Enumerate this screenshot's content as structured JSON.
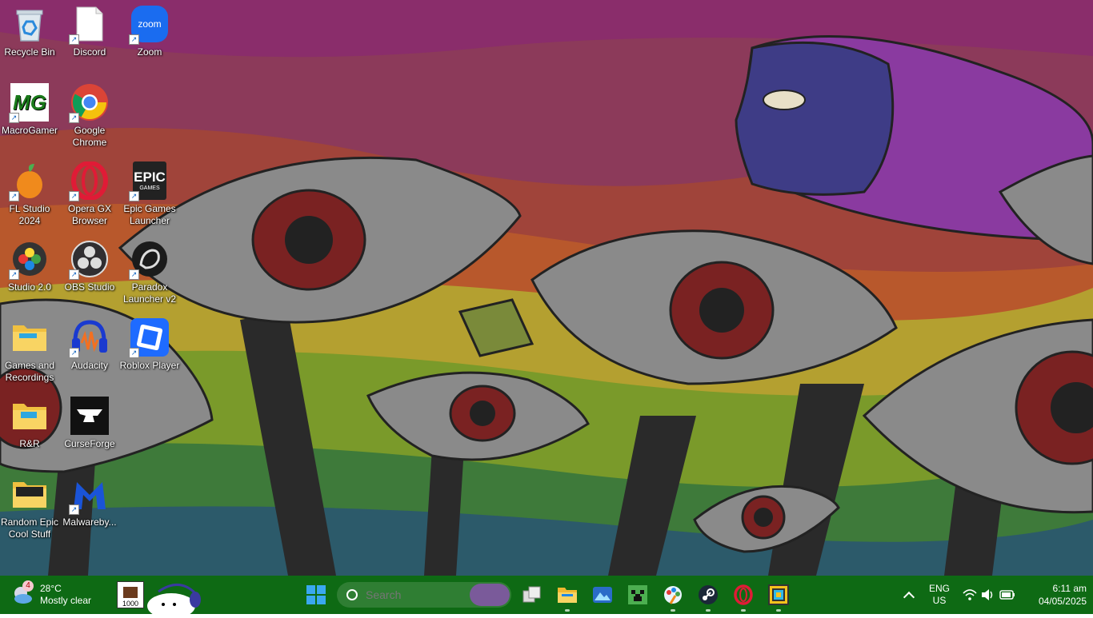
{
  "desktop": {
    "icons": [
      {
        "label": "Recycle Bin",
        "icon": "recycle-bin-icon",
        "shortcut": false
      },
      {
        "label": "Discord",
        "icon": "discord-file-icon",
        "shortcut": true
      },
      {
        "label": "Zoom",
        "icon": "zoom-icon",
        "shortcut": true
      },
      {
        "label": "MacroGamer",
        "icon": "macrogamer-icon",
        "shortcut": true
      },
      {
        "label": "Google Chrome",
        "icon": "chrome-icon",
        "shortcut": true
      },
      {
        "label": "FL Studio 2024",
        "icon": "fl-studio-icon",
        "shortcut": true
      },
      {
        "label": "Opera GX Browser",
        "icon": "opera-gx-icon",
        "shortcut": true
      },
      {
        "label": "Epic Games Launcher",
        "icon": "epic-games-icon",
        "shortcut": true
      },
      {
        "label": "Studio 2.0",
        "icon": "studio-icon",
        "shortcut": true
      },
      {
        "label": "OBS Studio",
        "icon": "obs-icon",
        "shortcut": true
      },
      {
        "label": "Paradox Launcher v2",
        "icon": "paradox-icon",
        "shortcut": true
      },
      {
        "label": "Games and Recordings",
        "icon": "folder-icon",
        "shortcut": false
      },
      {
        "label": "Audacity",
        "icon": "audacity-icon",
        "shortcut": true
      },
      {
        "label": "Roblox Player",
        "icon": "roblox-icon",
        "shortcut": true
      },
      {
        "label": "R&R",
        "icon": "folder-icon",
        "shortcut": false
      },
      {
        "label": "CurseForge",
        "icon": "curseforge-icon",
        "shortcut": false
      },
      {
        "label": "Random Epic Cool Stuff",
        "icon": "folder-icon",
        "shortcut": false
      },
      {
        "label": "Malwareby...",
        "icon": "malwarebytes-icon",
        "shortcut": true
      },
      {
        "label": "EPIC",
        "icon": "epic-logo-text",
        "shortcut": false
      },
      {
        "label": "GAMES",
        "icon": "epic-logo-text",
        "shortcut": false
      },
      {
        "label": "zoom",
        "icon": "zoom-logo-text",
        "shortcut": false
      },
      {
        "label": "MG",
        "icon": "macrogamer-logo-text",
        "shortcut": false
      }
    ]
  },
  "taskbar": {
    "weather": {
      "temp": "28°C",
      "condition": "Mostly clear",
      "badge": "4"
    },
    "widget_counter": "1000",
    "search": {
      "placeholder": "Search"
    },
    "apps": [
      {
        "name": "task-view-icon",
        "running": false
      },
      {
        "name": "file-explorer-icon",
        "running": true
      },
      {
        "name": "photos-icon",
        "running": false
      },
      {
        "name": "minecraft-icon",
        "running": false
      },
      {
        "name": "paint-icon",
        "running": true
      },
      {
        "name": "steam-icon",
        "running": true
      },
      {
        "name": "opera-icon",
        "running": true
      },
      {
        "name": "geometry-dash-icon",
        "running": true
      }
    ],
    "lang": {
      "line1": "ENG",
      "line2": "US"
    },
    "clock": {
      "time": "6:11 am",
      "date": "04/05/2025"
    }
  },
  "colors": {
    "taskbar": "#0e6a14",
    "accent": "#0078d4"
  }
}
